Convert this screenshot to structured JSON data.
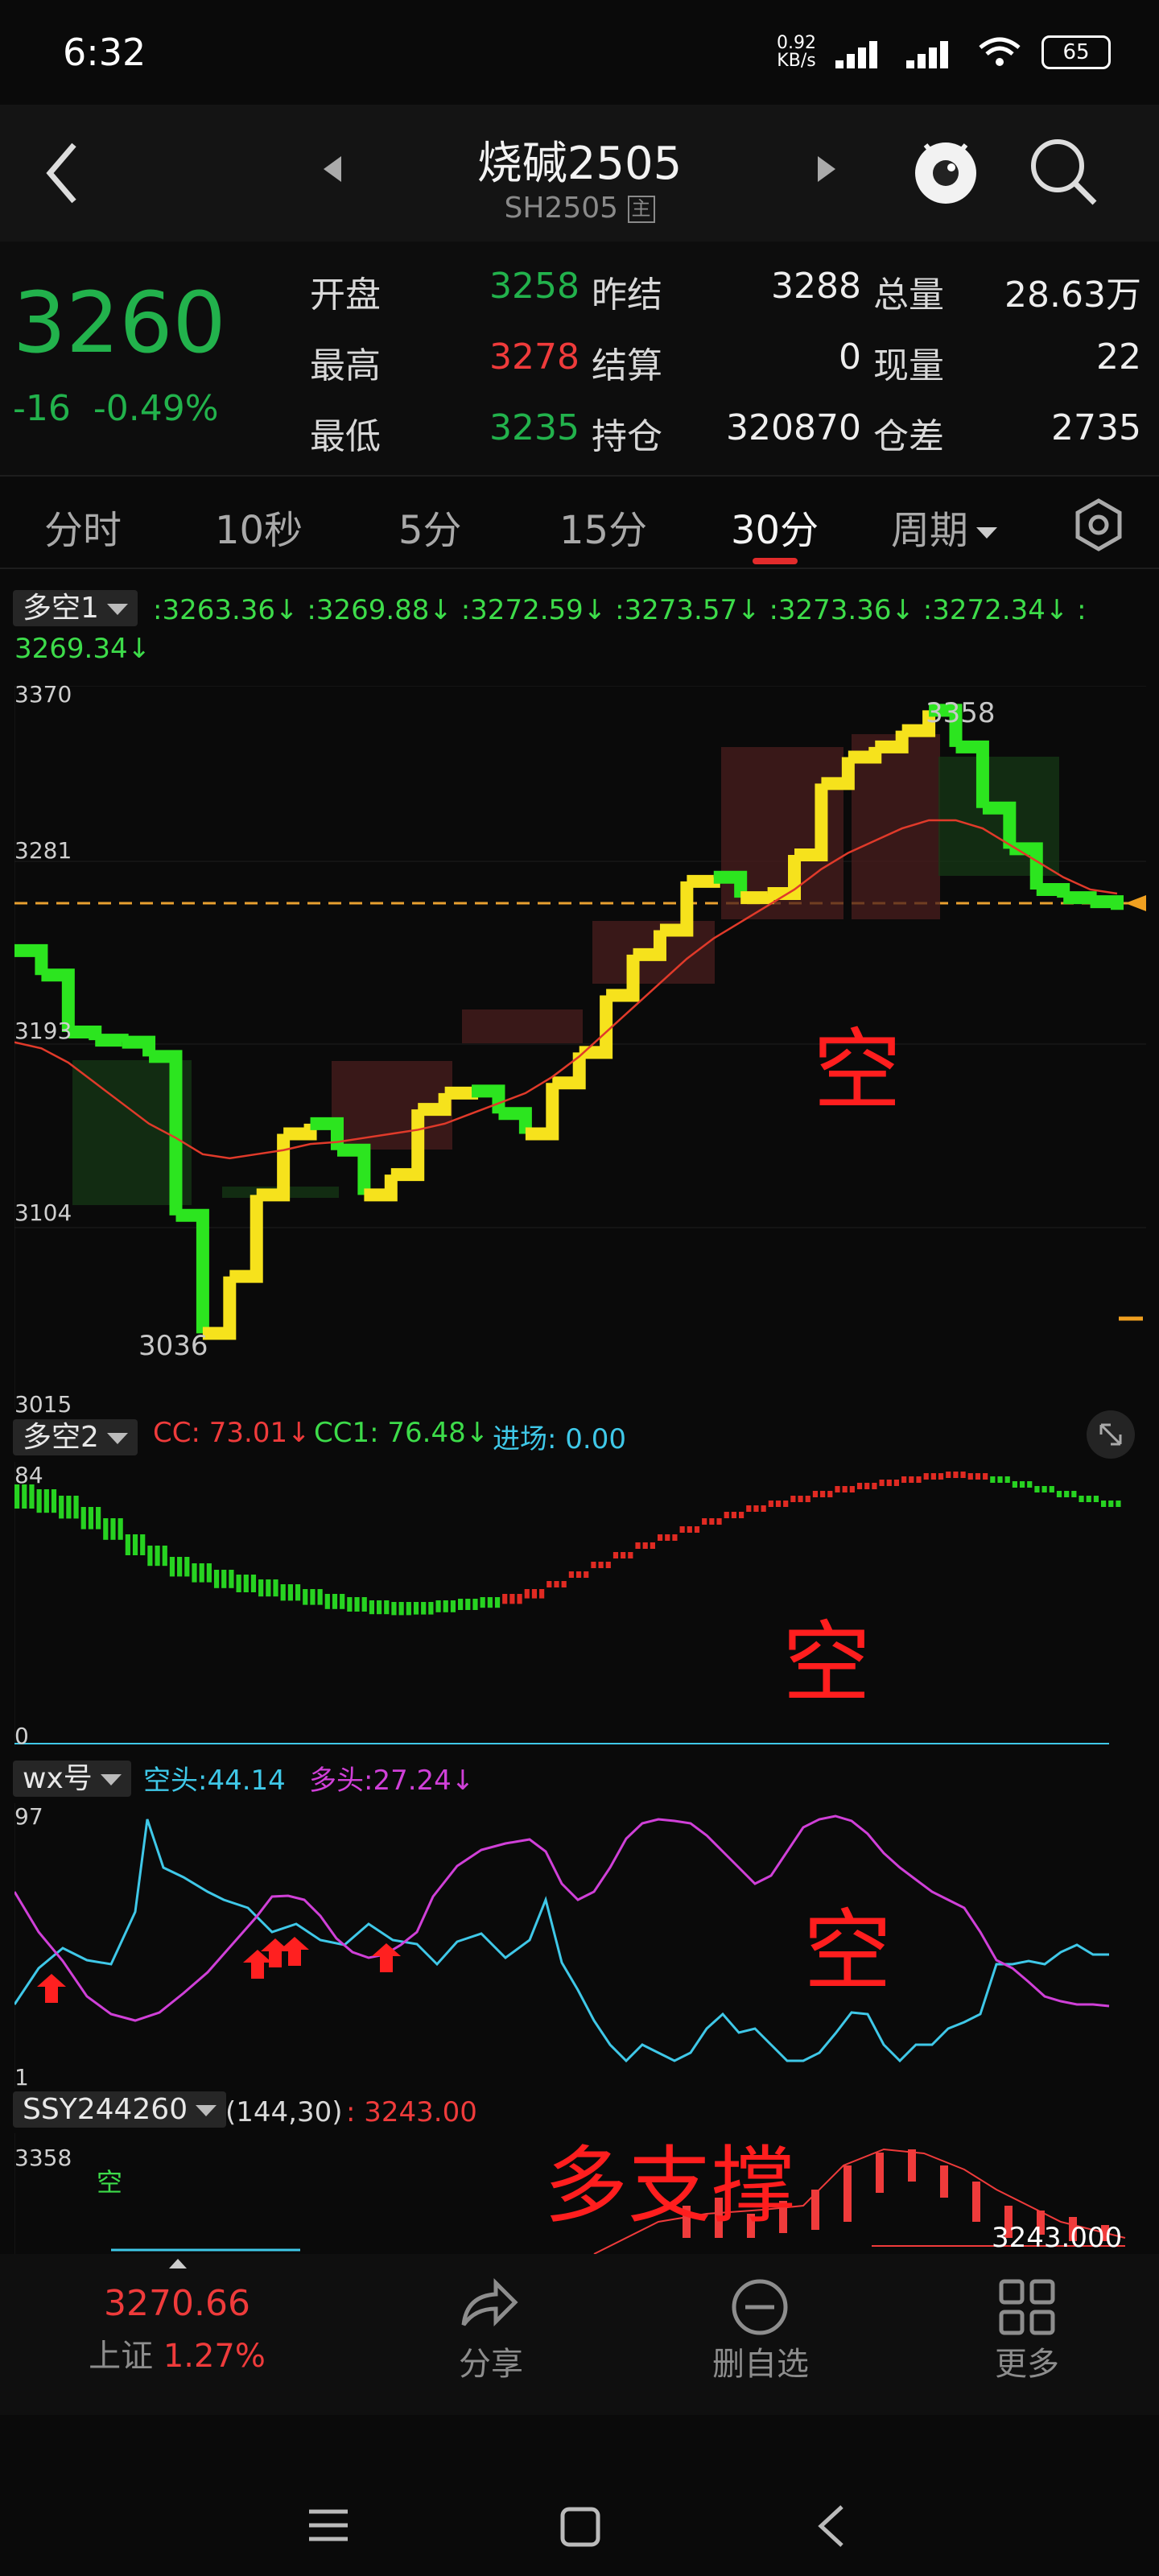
{
  "status": {
    "time": "6:32",
    "speed": "0.92\nKB/s",
    "battery": "65"
  },
  "header": {
    "title": "烧碱2505",
    "subtitle": "SH2505"
  },
  "quote": {
    "price": "3260",
    "change": "-16",
    "change_pct": "-0.49%",
    "labels": {
      "open": "开盘",
      "high": "最高",
      "low": "最低",
      "prev_settle": "昨结",
      "settle": "结算",
      "oi": "持仓",
      "volume": "总量",
      "cur_vol": "现量",
      "oi_chg": "仓差"
    },
    "values": {
      "open": "3258",
      "high": "3278",
      "low": "3235",
      "prev_settle": "3288",
      "settle": "0",
      "oi": "320870",
      "volume": "28.63万",
      "cur_vol": "22",
      "oi_chg": "2735"
    }
  },
  "tabs": [
    "分时",
    "10秒",
    "5分",
    "15分",
    "30分",
    "周期"
  ],
  "panel1": {
    "label": "多空1",
    "values": [
      ":3263.36↓",
      ":3269.88↓",
      ":3272.59↓",
      ":3273.57↓",
      ":3273.36↓",
      ":3272.34↓",
      ":",
      "3269.34↓"
    ],
    "axis": [
      "3370",
      "3281",
      "3193",
      "3104",
      "3015"
    ],
    "peak": "3358",
    "trough": "3036",
    "overlay": "空"
  },
  "panel2": {
    "label": "多空2",
    "cc": "CC: 73.01↓",
    "cc1": "CC1: 76.48↓",
    "entry": "进场: 0.00",
    "axis_top": "84",
    "axis_bottom": "0",
    "overlay": "空"
  },
  "panel3": {
    "label": "wx号",
    "short": "空头:44.14",
    "long": "多头:27.24↓",
    "axis_top": "97",
    "axis_bottom": "1",
    "overlay": "空"
  },
  "panel4": {
    "label": "SSY244260",
    "params": "(144,30)",
    "value": ": 3243.00",
    "axis_top": "3358",
    "overlay": "多支撑",
    "last": "3243.000",
    "mark": "空"
  },
  "bottom": {
    "index_value": "3270.66",
    "index_name": "上证",
    "index_pct": "1.27%",
    "share": "分享",
    "delete": "删自选",
    "more": "更多"
  },
  "chart_data": [
    {
      "type": "line",
      "title": "",
      "ylim": [
        3015,
        3370
      ],
      "series": [
        {
          "name": "",
          "values": [
            3240,
            3228,
            3200,
            3196,
            3195,
            3188,
            3110,
            3052,
            3080,
            3120,
            3150,
            3155,
            3142,
            3120,
            3130,
            3162,
            3170,
            3171,
            3160,
            3150,
            3175,
            3190,
            3218,
            3238,
            3250,
            3274,
            3276,
            3266,
            3268,
            3287,
            3322,
            3335,
            3340,
            3348,
            3358,
            3340,
            3310,
            3290,
            3270,
            3266,
            3264,
            3260
          ]
        },
        {
          "name": "",
          "values": [
            3195,
            3192,
            3185,
            3175,
            3165,
            3155,
            3148,
            3140,
            3138,
            3140,
            3142,
            3145,
            3146,
            3148,
            3150,
            3152,
            3155,
            3160,
            3165,
            3170,
            3178,
            3188,
            3200,
            3212,
            3224,
            3236,
            3246,
            3254,
            3262,
            3270,
            3280,
            3288,
            3294,
            3300,
            3304,
            3304,
            3300,
            3292,
            3284,
            3276,
            3270,
            3268
          ]
        }
      ]
    },
    {
      "type": "area",
      "title": "",
      "ylim": [
        0,
        84
      ],
      "series": [
        {
          "name": "CC",
          "values": [
            73.01
          ]
        },
        {
          "name": "CC1",
          "values": [
            76.48
          ]
        },
        {
          "name": "进场",
          "values": [
            0.0
          ]
        }
      ]
    },
    {
      "type": "line",
      "title": "",
      "ylim": [
        1,
        97
      ],
      "series": [
        {
          "name": "空头",
          "values": [
            44.14
          ]
        },
        {
          "name": "多头",
          "values": [
            27.24
          ]
        }
      ]
    }
  ]
}
